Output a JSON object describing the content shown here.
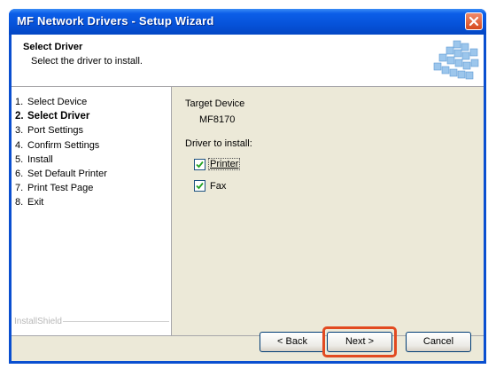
{
  "window": {
    "title": "MF Network Drivers - Setup Wizard"
  },
  "header": {
    "title": "Select Driver",
    "subtitle": "Select the driver to install."
  },
  "steps": [
    {
      "num": "1.",
      "label": "Select Device",
      "active": false
    },
    {
      "num": "2.",
      "label": "Select Driver",
      "active": true
    },
    {
      "num": "3.",
      "label": "Port Settings",
      "active": false
    },
    {
      "num": "4.",
      "label": "Confirm Settings",
      "active": false
    },
    {
      "num": "5.",
      "label": "Install",
      "active": false
    },
    {
      "num": "6.",
      "label": "Set Default Printer",
      "active": false
    },
    {
      "num": "7.",
      "label": "Print Test Page",
      "active": false
    },
    {
      "num": "8.",
      "label": "Exit",
      "active": false
    }
  ],
  "brand": "InstallShield",
  "main": {
    "target_label": "Target Device",
    "target_value": "MF8170",
    "driver_label": "Driver to install:",
    "printer": {
      "label": "Printer",
      "checked": true
    },
    "fax": {
      "label": "Fax",
      "checked": true
    }
  },
  "buttons": {
    "back": "< Back",
    "next": "Next >",
    "cancel": "Cancel"
  },
  "colors": {
    "titlebar": "#0652d9",
    "highlight": "#e24a20",
    "dialog_bg": "#ece9d8"
  }
}
